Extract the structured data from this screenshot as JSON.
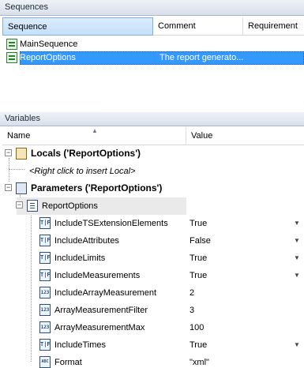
{
  "sequences_panel": {
    "title": "Sequences"
  },
  "sequences_table": {
    "columns": [
      "Sequence",
      "Comment",
      "Requirement"
    ],
    "rows": [
      {
        "name": "MainSequence",
        "comment": ""
      },
      {
        "name": "ReportOptions",
        "comment": "The report generato..."
      }
    ]
  },
  "variables_panel": {
    "title": "Variables"
  },
  "variables_table": {
    "columns": [
      "Name",
      "Value"
    ],
    "locals": {
      "label": "Locals ('ReportOptions')",
      "hint": "<Right click to insert Local>"
    },
    "parameters": {
      "label": "Parameters ('ReportOptions')"
    },
    "container": {
      "label": "ReportOptions"
    },
    "items": [
      {
        "name": "IncludeTSExtensionElements",
        "value": "True",
        "type_icon": "boolean-icon",
        "dropdown": true
      },
      {
        "name": "IncludeAttributes",
        "value": "False",
        "type_icon": "boolean-icon",
        "dropdown": true
      },
      {
        "name": "IncludeLimits",
        "value": "True",
        "type_icon": "boolean-icon",
        "dropdown": true
      },
      {
        "name": "IncludeMeasurements",
        "value": "True",
        "type_icon": "boolean-icon",
        "dropdown": true
      },
      {
        "name": "IncludeArrayMeasurement",
        "value": "2",
        "type_icon": "number-icon",
        "dropdown": false
      },
      {
        "name": "ArrayMeasurementFilter",
        "value": "3",
        "type_icon": "number-icon",
        "dropdown": false
      },
      {
        "name": "ArrayMeasurementMax",
        "value": "100",
        "type_icon": "number-icon",
        "dropdown": false
      },
      {
        "name": "IncludeTimes",
        "value": "True",
        "type_icon": "boolean-icon",
        "dropdown": true
      },
      {
        "name": "Format",
        "value": "\"xml\"",
        "type_icon": "string-icon",
        "dropdown": false
      }
    ]
  },
  "icon_glyphs": {
    "boolean": "T|F",
    "number": "123",
    "string": "ABC"
  },
  "colors": {
    "selection": "#3399ff",
    "panel_header": "#dde4ee"
  }
}
